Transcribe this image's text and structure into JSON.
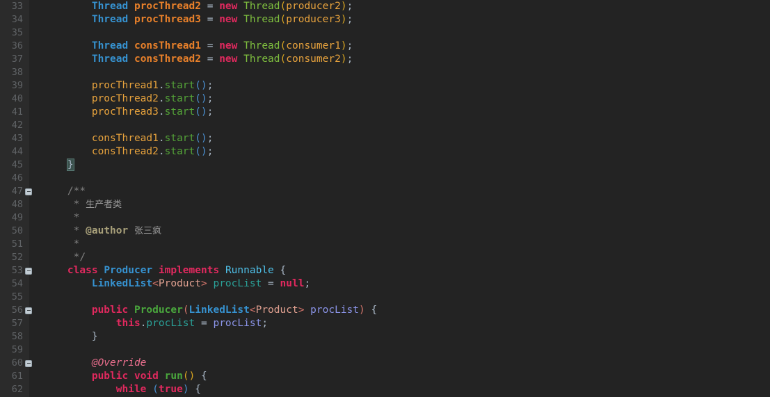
{
  "editor": {
    "name": "java-code-editor",
    "language": "java",
    "theme": "darcula",
    "background_color": "#232323",
    "gutter_color": "#2b2b2b",
    "line_number_color": "#606366",
    "first_visible_line": 33,
    "last_visible_line": 62,
    "indent_width": 4
  },
  "palette": {
    "type_declaration": "#3692d0",
    "class_reference": "#4fc1e9",
    "local_variable": "#e8802a",
    "keyword": "#e0295e",
    "constructor_call": "#7fbf3f",
    "method_call": "#4aa83d",
    "field": "#2aa198",
    "parameter": "#8b94e8",
    "generic_type": "#e0a090",
    "comment": "#808080",
    "javadoc_tag": "#a8a07a",
    "annotation": "#eb6f8e",
    "default_text": "#a9b7c6"
  },
  "lines": [
    {
      "n": 33,
      "fold": false,
      "tokens": [
        {
          "t": "        ",
          "c": "t-punct"
        },
        {
          "t": "Thread",
          "c": "t-type"
        },
        {
          "t": " ",
          "c": "t-punct"
        },
        {
          "t": "procThread2",
          "c": "t-var"
        },
        {
          "t": " = ",
          "c": "t-punct"
        },
        {
          "t": "new",
          "c": "t-kw"
        },
        {
          "t": " ",
          "c": "t-punct"
        },
        {
          "t": "Thread",
          "c": "t-ctor"
        },
        {
          "t": "(",
          "c": "t-paren-y"
        },
        {
          "t": "producer2",
          "c": "t-param"
        },
        {
          "t": ")",
          "c": "t-paren-y"
        },
        {
          "t": ";",
          "c": "t-punct"
        }
      ]
    },
    {
      "n": 34,
      "fold": false,
      "tokens": [
        {
          "t": "        ",
          "c": "t-punct"
        },
        {
          "t": "Thread",
          "c": "t-type"
        },
        {
          "t": " ",
          "c": "t-punct"
        },
        {
          "t": "procThread3",
          "c": "t-var"
        },
        {
          "t": " = ",
          "c": "t-punct"
        },
        {
          "t": "new",
          "c": "t-kw"
        },
        {
          "t": " ",
          "c": "t-punct"
        },
        {
          "t": "Thread",
          "c": "t-ctor"
        },
        {
          "t": "(",
          "c": "t-paren-y"
        },
        {
          "t": "producer3",
          "c": "t-param"
        },
        {
          "t": ")",
          "c": "t-paren-y"
        },
        {
          "t": ";",
          "c": "t-punct"
        }
      ]
    },
    {
      "n": 35,
      "fold": false,
      "tokens": []
    },
    {
      "n": 36,
      "fold": false,
      "tokens": [
        {
          "t": "        ",
          "c": "t-punct"
        },
        {
          "t": "Thread",
          "c": "t-type"
        },
        {
          "t": " ",
          "c": "t-punct"
        },
        {
          "t": "consThread1",
          "c": "t-var"
        },
        {
          "t": " = ",
          "c": "t-punct"
        },
        {
          "t": "new",
          "c": "t-kw"
        },
        {
          "t": " ",
          "c": "t-punct"
        },
        {
          "t": "Thread",
          "c": "t-ctor"
        },
        {
          "t": "(",
          "c": "t-paren-y"
        },
        {
          "t": "consumer1",
          "c": "t-param"
        },
        {
          "t": ")",
          "c": "t-paren-y"
        },
        {
          "t": ";",
          "c": "t-punct"
        }
      ]
    },
    {
      "n": 37,
      "fold": false,
      "tokens": [
        {
          "t": "        ",
          "c": "t-punct"
        },
        {
          "t": "Thread",
          "c": "t-type"
        },
        {
          "t": " ",
          "c": "t-punct"
        },
        {
          "t": "consThread2",
          "c": "t-var"
        },
        {
          "t": " = ",
          "c": "t-punct"
        },
        {
          "t": "new",
          "c": "t-kw"
        },
        {
          "t": " ",
          "c": "t-punct"
        },
        {
          "t": "Thread",
          "c": "t-ctor"
        },
        {
          "t": "(",
          "c": "t-paren-y"
        },
        {
          "t": "consumer2",
          "c": "t-param"
        },
        {
          "t": ")",
          "c": "t-paren-y"
        },
        {
          "t": ";",
          "c": "t-punct"
        }
      ]
    },
    {
      "n": 38,
      "fold": false,
      "tokens": []
    },
    {
      "n": 39,
      "fold": false,
      "tokens": [
        {
          "t": "        ",
          "c": "t-punct"
        },
        {
          "t": "procThread1",
          "c": "t-varplain"
        },
        {
          "t": ".",
          "c": "t-punct"
        },
        {
          "t": "start",
          "c": "t-methodg"
        },
        {
          "t": "(",
          "c": "t-paren-b"
        },
        {
          "t": ")",
          "c": "t-paren-b"
        },
        {
          "t": ";",
          "c": "t-punct"
        }
      ]
    },
    {
      "n": 40,
      "fold": false,
      "tokens": [
        {
          "t": "        ",
          "c": "t-punct"
        },
        {
          "t": "procThread2",
          "c": "t-varplain"
        },
        {
          "t": ".",
          "c": "t-punct"
        },
        {
          "t": "start",
          "c": "t-methodg"
        },
        {
          "t": "(",
          "c": "t-paren-b"
        },
        {
          "t": ")",
          "c": "t-paren-b"
        },
        {
          "t": ";",
          "c": "t-punct"
        }
      ]
    },
    {
      "n": 41,
      "fold": false,
      "tokens": [
        {
          "t": "        ",
          "c": "t-punct"
        },
        {
          "t": "procThread3",
          "c": "t-varplain"
        },
        {
          "t": ".",
          "c": "t-punct"
        },
        {
          "t": "start",
          "c": "t-methodg"
        },
        {
          "t": "(",
          "c": "t-paren-b"
        },
        {
          "t": ")",
          "c": "t-paren-b"
        },
        {
          "t": ";",
          "c": "t-punct"
        }
      ]
    },
    {
      "n": 42,
      "fold": false,
      "tokens": []
    },
    {
      "n": 43,
      "fold": false,
      "tokens": [
        {
          "t": "        ",
          "c": "t-punct"
        },
        {
          "t": "consThread1",
          "c": "t-varplain"
        },
        {
          "t": ".",
          "c": "t-punct"
        },
        {
          "t": "start",
          "c": "t-methodg"
        },
        {
          "t": "(",
          "c": "t-paren-b"
        },
        {
          "t": ")",
          "c": "t-paren-b"
        },
        {
          "t": ";",
          "c": "t-punct"
        }
      ]
    },
    {
      "n": 44,
      "fold": false,
      "tokens": [
        {
          "t": "        ",
          "c": "t-punct"
        },
        {
          "t": "consThread2",
          "c": "t-varplain"
        },
        {
          "t": ".",
          "c": "t-punct"
        },
        {
          "t": "start",
          "c": "t-methodg"
        },
        {
          "t": "(",
          "c": "t-paren-b"
        },
        {
          "t": ")",
          "c": "t-paren-b"
        },
        {
          "t": ";",
          "c": "t-punct"
        }
      ]
    },
    {
      "n": 45,
      "fold": false,
      "tokens": [
        {
          "t": "    ",
          "c": "t-punct"
        },
        {
          "t": "}",
          "c": "t-punct brace-hl"
        }
      ]
    },
    {
      "n": 46,
      "fold": false,
      "tokens": []
    },
    {
      "n": 47,
      "fold": true,
      "tokens": [
        {
          "t": "    ",
          "c": "t-punct"
        },
        {
          "t": "/**",
          "c": "t-comment"
        }
      ]
    },
    {
      "n": 48,
      "fold": false,
      "tokens": [
        {
          "t": "     ",
          "c": "t-punct"
        },
        {
          "t": "* ",
          "c": "t-comment"
        },
        {
          "t": "生产者类",
          "c": "t-cjk"
        }
      ]
    },
    {
      "n": 49,
      "fold": false,
      "tokens": [
        {
          "t": "     ",
          "c": "t-punct"
        },
        {
          "t": "*",
          "c": "t-comment"
        }
      ]
    },
    {
      "n": 50,
      "fold": false,
      "tokens": [
        {
          "t": "     ",
          "c": "t-punct"
        },
        {
          "t": "* ",
          "c": "t-comment"
        },
        {
          "t": "@author",
          "c": "t-tag"
        },
        {
          "t": " ",
          "c": "t-comment"
        },
        {
          "t": "张三疯",
          "c": "t-cjk"
        }
      ]
    },
    {
      "n": 51,
      "fold": false,
      "tokens": [
        {
          "t": "     ",
          "c": "t-punct"
        },
        {
          "t": "*",
          "c": "t-comment"
        }
      ]
    },
    {
      "n": 52,
      "fold": false,
      "tokens": [
        {
          "t": "     ",
          "c": "t-punct"
        },
        {
          "t": "*/",
          "c": "t-comment"
        }
      ]
    },
    {
      "n": 53,
      "fold": true,
      "tokens": [
        {
          "t": "    ",
          "c": "t-punct"
        },
        {
          "t": "class",
          "c": "t-kw"
        },
        {
          "t": " ",
          "c": "t-punct"
        },
        {
          "t": "Producer",
          "c": "t-type"
        },
        {
          "t": " ",
          "c": "t-punct"
        },
        {
          "t": "implements",
          "c": "t-kw"
        },
        {
          "t": " ",
          "c": "t-punct"
        },
        {
          "t": "Runnable",
          "c": "t-class"
        },
        {
          "t": " {",
          "c": "t-punct"
        }
      ]
    },
    {
      "n": 54,
      "fold": false,
      "tokens": [
        {
          "t": "        ",
          "c": "t-punct"
        },
        {
          "t": "LinkedList",
          "c": "t-type"
        },
        {
          "t": "<",
          "c": "t-paren-s"
        },
        {
          "t": "Product",
          "c": "t-generic"
        },
        {
          "t": ">",
          "c": "t-paren-s"
        },
        {
          "t": " ",
          "c": "t-punct"
        },
        {
          "t": "procList",
          "c": "t-field"
        },
        {
          "t": " = ",
          "c": "t-punct"
        },
        {
          "t": "null",
          "c": "t-kw"
        },
        {
          "t": ";",
          "c": "t-punct"
        }
      ]
    },
    {
      "n": 55,
      "fold": false,
      "tokens": []
    },
    {
      "n": 56,
      "fold": true,
      "tokens": [
        {
          "t": "        ",
          "c": "t-punct"
        },
        {
          "t": "public",
          "c": "t-kw"
        },
        {
          "t": " ",
          "c": "t-punct"
        },
        {
          "t": "Producer",
          "c": "t-greenbold"
        },
        {
          "t": "(",
          "c": "t-paren-s"
        },
        {
          "t": "LinkedList",
          "c": "t-type"
        },
        {
          "t": "<",
          "c": "t-paren-s"
        },
        {
          "t": "Product",
          "c": "t-generic"
        },
        {
          "t": ">",
          "c": "t-paren-s"
        },
        {
          "t": " ",
          "c": "t-punct"
        },
        {
          "t": "procList",
          "c": "t-arg"
        },
        {
          "t": ")",
          "c": "t-paren-s"
        },
        {
          "t": " {",
          "c": "t-punct"
        }
      ]
    },
    {
      "n": 57,
      "fold": false,
      "tokens": [
        {
          "t": "            ",
          "c": "t-punct"
        },
        {
          "t": "this",
          "c": "t-kw"
        },
        {
          "t": ".",
          "c": "t-punct"
        },
        {
          "t": "procList",
          "c": "t-field"
        },
        {
          "t": " = ",
          "c": "t-punct"
        },
        {
          "t": "procList",
          "c": "t-arg"
        },
        {
          "t": ";",
          "c": "t-punct"
        }
      ]
    },
    {
      "n": 58,
      "fold": false,
      "tokens": [
        {
          "t": "        ",
          "c": "t-punct"
        },
        {
          "t": "}",
          "c": "t-punct"
        }
      ]
    },
    {
      "n": 59,
      "fold": false,
      "tokens": []
    },
    {
      "n": 60,
      "fold": true,
      "tokens": [
        {
          "t": "        ",
          "c": "t-punct"
        },
        {
          "t": "@Override",
          "c": "t-anno"
        }
      ]
    },
    {
      "n": 61,
      "fold": false,
      "tokens": [
        {
          "t": "        ",
          "c": "t-punct"
        },
        {
          "t": "public",
          "c": "t-kw"
        },
        {
          "t": " ",
          "c": "t-punct"
        },
        {
          "t": "void",
          "c": "t-kw"
        },
        {
          "t": " ",
          "c": "t-punct"
        },
        {
          "t": "run",
          "c": "t-method"
        },
        {
          "t": "(",
          "c": "t-paren-y"
        },
        {
          "t": ")",
          "c": "t-paren-y"
        },
        {
          "t": " {",
          "c": "t-punct"
        }
      ]
    },
    {
      "n": 62,
      "fold": false,
      "tokens": [
        {
          "t": "            ",
          "c": "t-punct"
        },
        {
          "t": "while",
          "c": "t-kw"
        },
        {
          "t": " ",
          "c": "t-punct"
        },
        {
          "t": "(",
          "c": "t-paren-b"
        },
        {
          "t": "true",
          "c": "t-kw"
        },
        {
          "t": ")",
          "c": "t-paren-b"
        },
        {
          "t": " {",
          "c": "t-punct"
        }
      ]
    }
  ]
}
